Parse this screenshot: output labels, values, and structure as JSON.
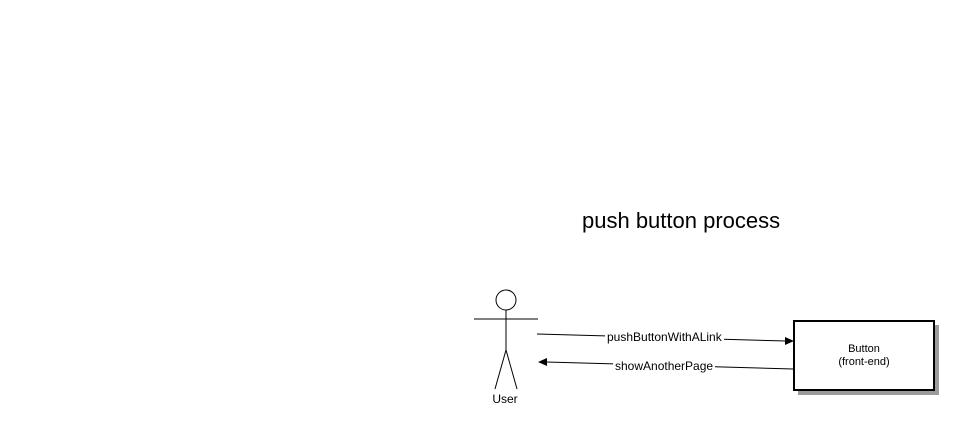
{
  "diagram": {
    "title": "push button process",
    "actor": {
      "label": "User"
    },
    "component": {
      "line1": "Button",
      "line2": "(front-end)"
    },
    "messages": [
      {
        "label": "pushButtonWithALink",
        "direction": "user-to-button"
      },
      {
        "label": "showAnotherPage",
        "direction": "button-to-user"
      }
    ]
  }
}
